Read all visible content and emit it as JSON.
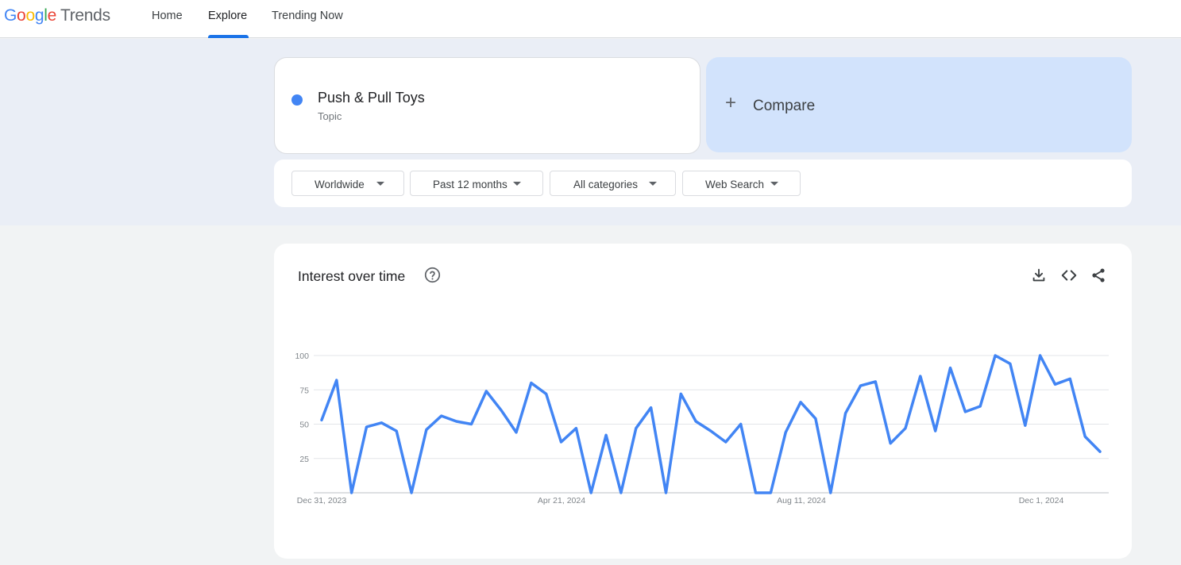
{
  "header": {
    "logo": {
      "letters": [
        "G",
        "o",
        "o",
        "g",
        "l",
        "e"
      ],
      "product": "Trends"
    },
    "nav": [
      {
        "label": "Home"
      },
      {
        "label": "Explore"
      },
      {
        "label": "Trending Now"
      }
    ]
  },
  "search_term": {
    "name": "Push & Pull Toys",
    "type": "Topic",
    "color": "#4285f4"
  },
  "compare": {
    "icon": "plus-icon",
    "label": "Compare"
  },
  "filters": [
    {
      "label": "Worldwide"
    },
    {
      "label": "Past 12 months"
    },
    {
      "label": "All categories"
    },
    {
      "label": "Web Search"
    }
  ],
  "interest_card": {
    "title": "Interest over time",
    "icons": [
      "help-icon",
      "download-icon",
      "embed-code-icon",
      "share-icon"
    ]
  },
  "chart_data": {
    "type": "line",
    "title": "Interest over time",
    "xlabel": "",
    "ylabel": "",
    "ylim": [
      0,
      100
    ],
    "y_ticks": [
      "100",
      "75",
      "50",
      "25"
    ],
    "x_tick_labels": [
      "Dec 31, 2023",
      "Apr 21, 2024",
      "Aug 11, 2024",
      "Dec 1, 2024"
    ],
    "grid": true,
    "series": [
      {
        "color": "#4285f4",
        "values": [
          53,
          82,
          0,
          48,
          51,
          45,
          0,
          46,
          56,
          52,
          50,
          74,
          60,
          44,
          80,
          72,
          37,
          47,
          0,
          42,
          0,
          47,
          62,
          0,
          72,
          52,
          45,
          37,
          50,
          0,
          0,
          44,
          66,
          54,
          0,
          58,
          78,
          81,
          36,
          47,
          85,
          45,
          91,
          59,
          63,
          100,
          94,
          49,
          100,
          79,
          83,
          41,
          30
        ]
      }
    ]
  }
}
